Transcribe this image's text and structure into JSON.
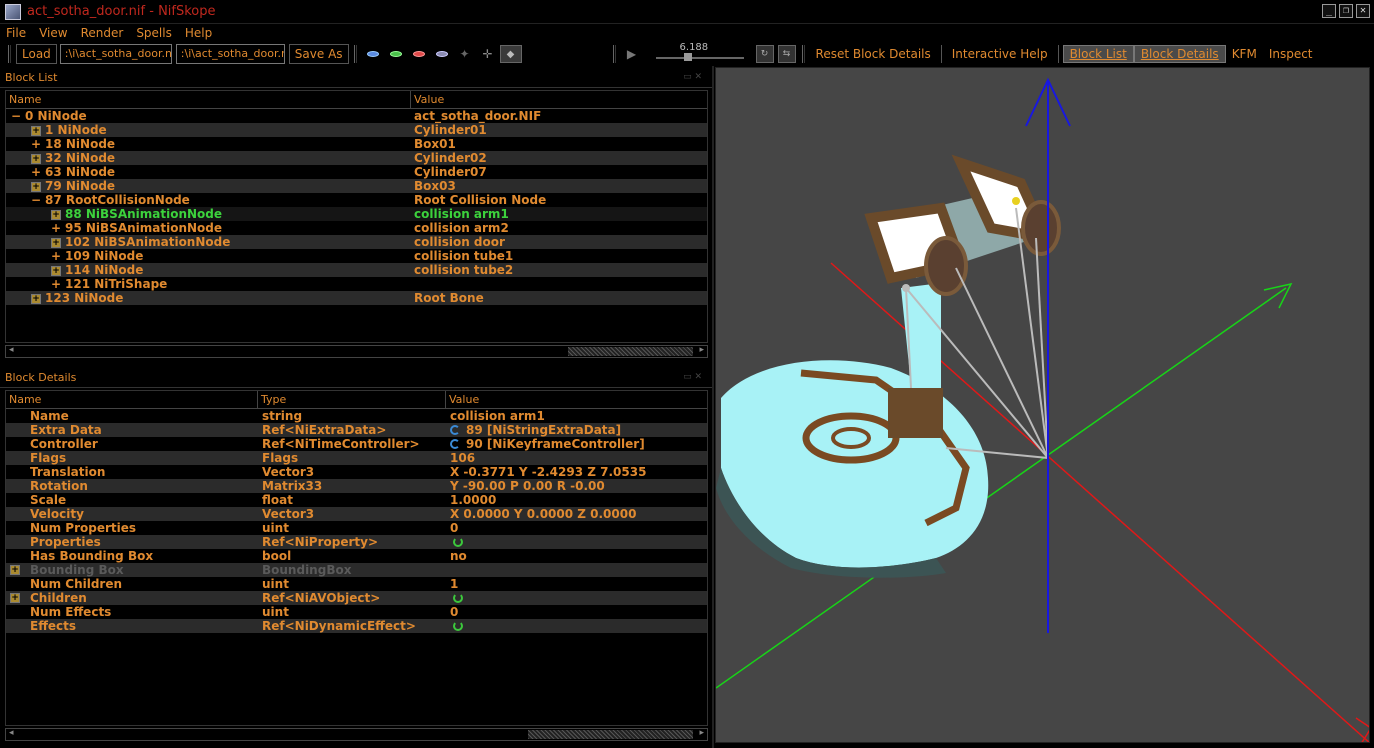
{
  "window": {
    "title": "act_sotha_door.nif - NifSkope",
    "controls": [
      "_",
      "❐",
      "✕"
    ]
  },
  "menu": [
    "File",
    "View",
    "Render",
    "Spells",
    "Help"
  ],
  "toolbar": {
    "load_label": "Load",
    "load_path": ":\\i\\act_sotha_door.nif",
    "save_path": ":\\i\\act_sotha_door.nif",
    "save_as_label": "Save As",
    "time_value": "6.188",
    "links": [
      "Reset Block Details",
      "Interactive Help",
      "Block List",
      "Block Details",
      "KFM",
      "Inspect"
    ],
    "active_links": [
      "Block List",
      "Block Details"
    ]
  },
  "block_list": {
    "title": "Block List",
    "columns": [
      "Name",
      "Value"
    ],
    "rows": [
      {
        "depth": 0,
        "expander": "-",
        "name": "0 NiNode",
        "value": "act_sotha_door.NIF"
      },
      {
        "depth": 1,
        "expander": "+box",
        "name": "1 NiNode",
        "value": "Cylinder01"
      },
      {
        "depth": 1,
        "expander": "+",
        "name": "18 NiNode",
        "value": "Box01"
      },
      {
        "depth": 1,
        "expander": "+box",
        "name": "32 NiNode",
        "value": "Cylinder02"
      },
      {
        "depth": 1,
        "expander": "+",
        "name": "63 NiNode",
        "value": "Cylinder07"
      },
      {
        "depth": 1,
        "expander": "+box",
        "name": "79 NiNode",
        "value": "Box03"
      },
      {
        "depth": 1,
        "expander": "-",
        "name": "87 RootCollisionNode",
        "value": "Root Collision Node"
      },
      {
        "depth": 2,
        "expander": "+box",
        "name": "88 NiBSAnimationNode",
        "value": "collision arm1",
        "selected": true
      },
      {
        "depth": 2,
        "expander": "+",
        "name": "95 NiBSAnimationNode",
        "value": "collision arm2"
      },
      {
        "depth": 2,
        "expander": "+box",
        "name": "102 NiBSAnimationNode",
        "value": "collision door"
      },
      {
        "depth": 2,
        "expander": "+",
        "name": "109 NiNode",
        "value": "collision tube1"
      },
      {
        "depth": 2,
        "expander": "+box",
        "name": "114 NiNode",
        "value": "collision tube2"
      },
      {
        "depth": 2,
        "expander": "+",
        "name": "121 NiTriShape",
        "value": ""
      },
      {
        "depth": 1,
        "expander": "+box",
        "name": "123 NiNode",
        "value": "Root Bone"
      }
    ]
  },
  "block_details": {
    "title": "Block Details",
    "columns": [
      "Name",
      "Type",
      "Value"
    ],
    "rows": [
      {
        "name": "Name",
        "type": "string",
        "value": "collision arm1"
      },
      {
        "name": "Extra Data",
        "type": "Ref<NiExtraData>",
        "value": "89 [NiStringExtraData]",
        "icon": "link"
      },
      {
        "name": "Controller",
        "type": "Ref<NiTimeController>",
        "value": "90 [NiKeyframeController]",
        "icon": "link"
      },
      {
        "name": "Flags",
        "type": "Flags",
        "value": "106"
      },
      {
        "name": "Translation",
        "type": "Vector3",
        "value": "X -0.3771 Y -2.4293 Z 7.0535"
      },
      {
        "name": "Rotation",
        "type": "Matrix33",
        "value": "Y -90.00 P 0.00 R -0.00"
      },
      {
        "name": "Scale",
        "type": "float",
        "value": "1.0000"
      },
      {
        "name": "Velocity",
        "type": "Vector3",
        "value": "X 0.0000 Y 0.0000 Z 0.0000"
      },
      {
        "name": "Num Properties",
        "type": "uint",
        "value": "0"
      },
      {
        "name": "Properties",
        "type": "Ref<NiProperty>",
        "value": "",
        "icon": "refresh"
      },
      {
        "name": "Has Bounding Box",
        "type": "bool",
        "value": "no"
      },
      {
        "name": "Bounding Box",
        "type": "BoundingBox",
        "value": "",
        "disabled": true,
        "expandable": true
      },
      {
        "name": "Num Children",
        "type": "uint",
        "value": "1"
      },
      {
        "name": "Children",
        "type": "Ref<NiAVObject>",
        "value": "",
        "icon": "refresh",
        "expandable": true
      },
      {
        "name": "Num Effects",
        "type": "uint",
        "value": "0"
      },
      {
        "name": "Effects",
        "type": "Ref<NiDynamicEffect>",
        "value": "",
        "icon": "refresh"
      }
    ]
  },
  "colors": {
    "accent_text": "#e08a30",
    "selected_text": "#3cd23c",
    "title_text": "#c0281e",
    "viewport_bg": "#464646",
    "axis_x": "#e01818",
    "axis_y": "#18d418",
    "axis_z": "#1818e0"
  }
}
